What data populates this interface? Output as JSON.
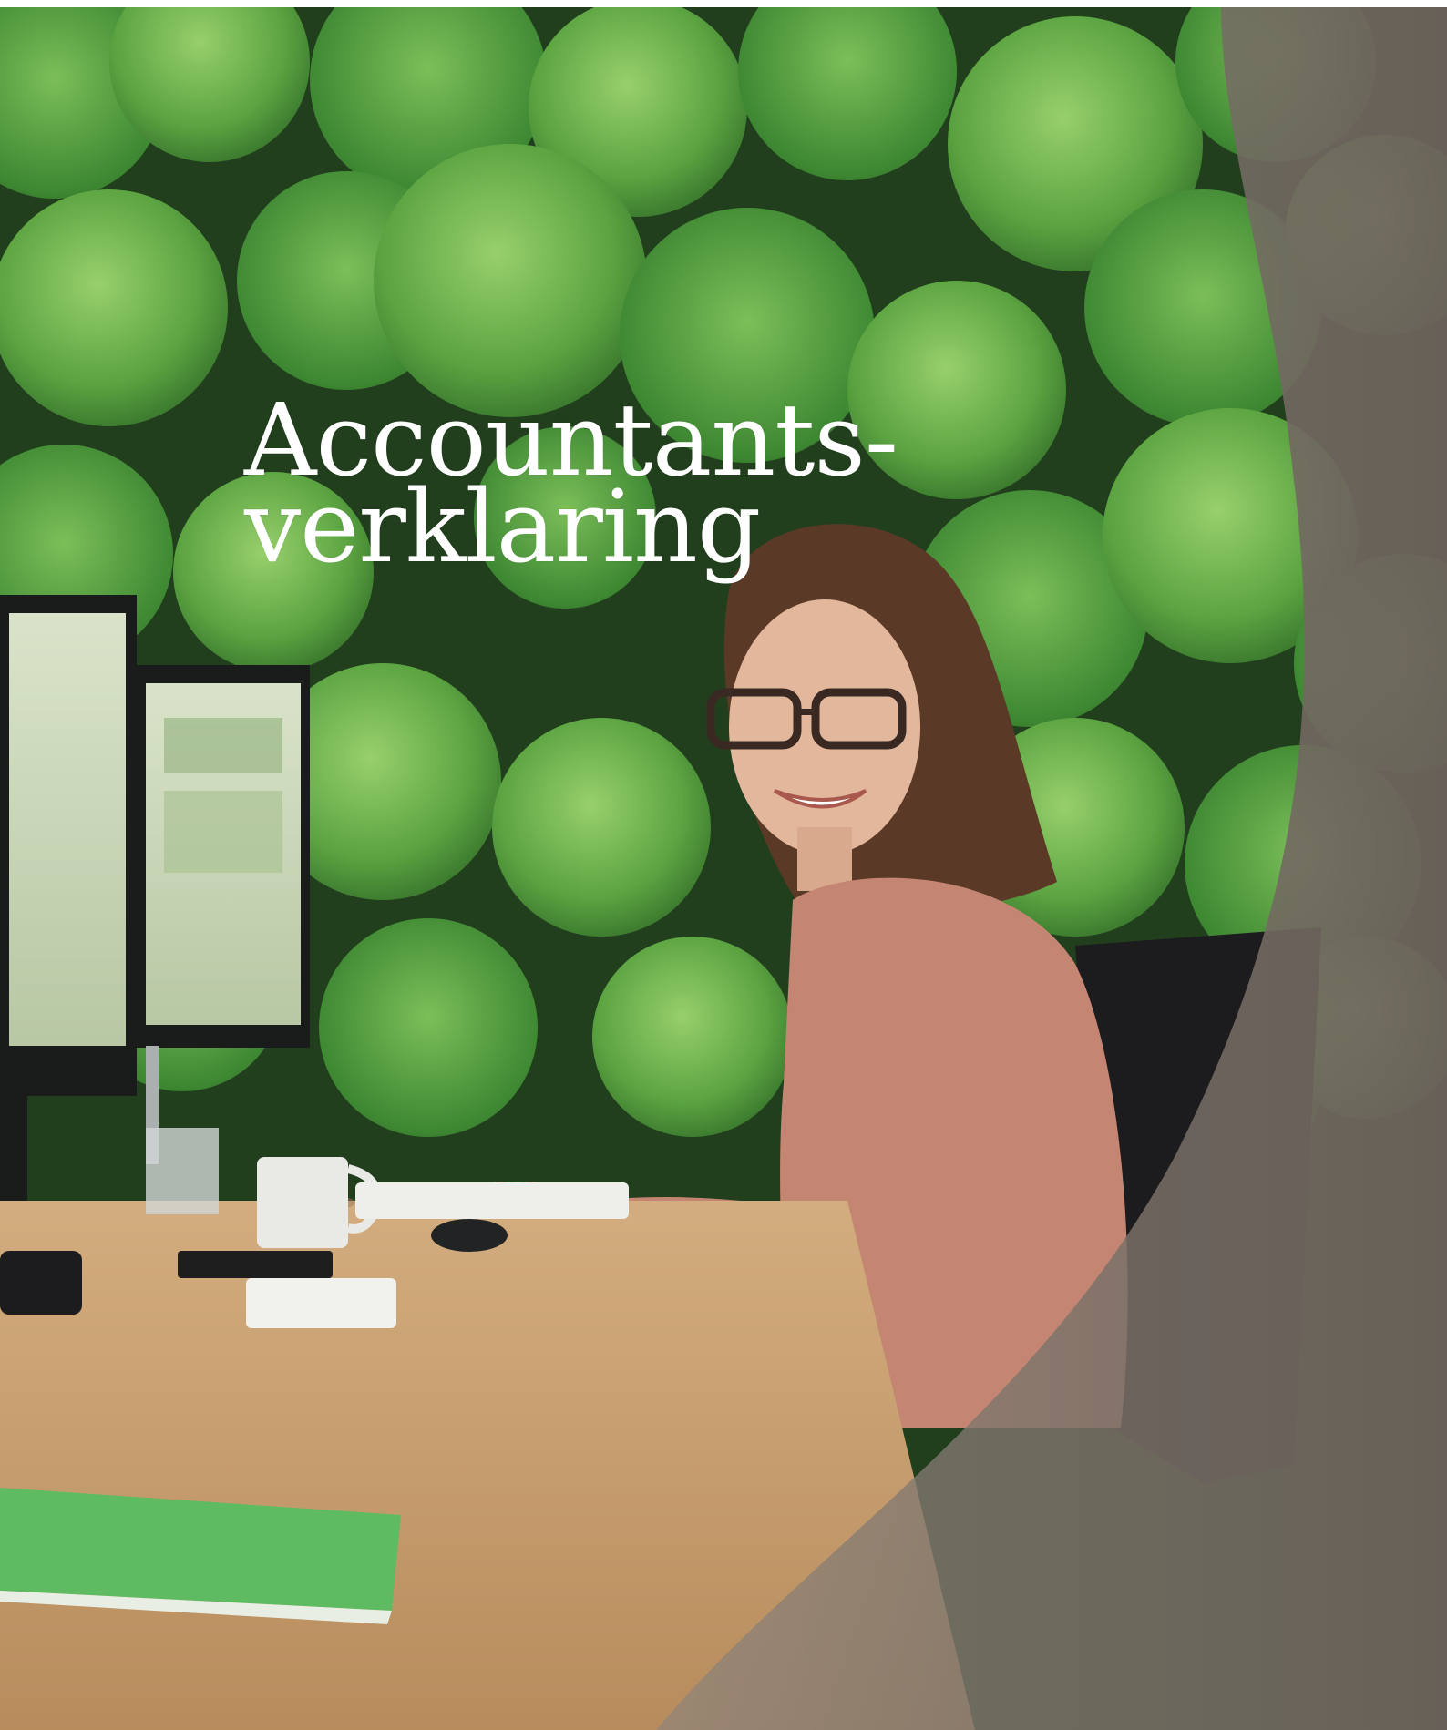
{
  "headline": {
    "line1": "Accountants-",
    "line2": "verklaring"
  },
  "photo": {
    "subject": "woman-at-desk",
    "background": "clover-wall",
    "colors": {
      "leaf_light": "#7fc35a",
      "leaf_mid": "#4f9a3a",
      "leaf_dark": "#1f3d1a",
      "desk": "#c9a273",
      "blouse": "#c48672",
      "hair": "#5a3a27"
    }
  }
}
